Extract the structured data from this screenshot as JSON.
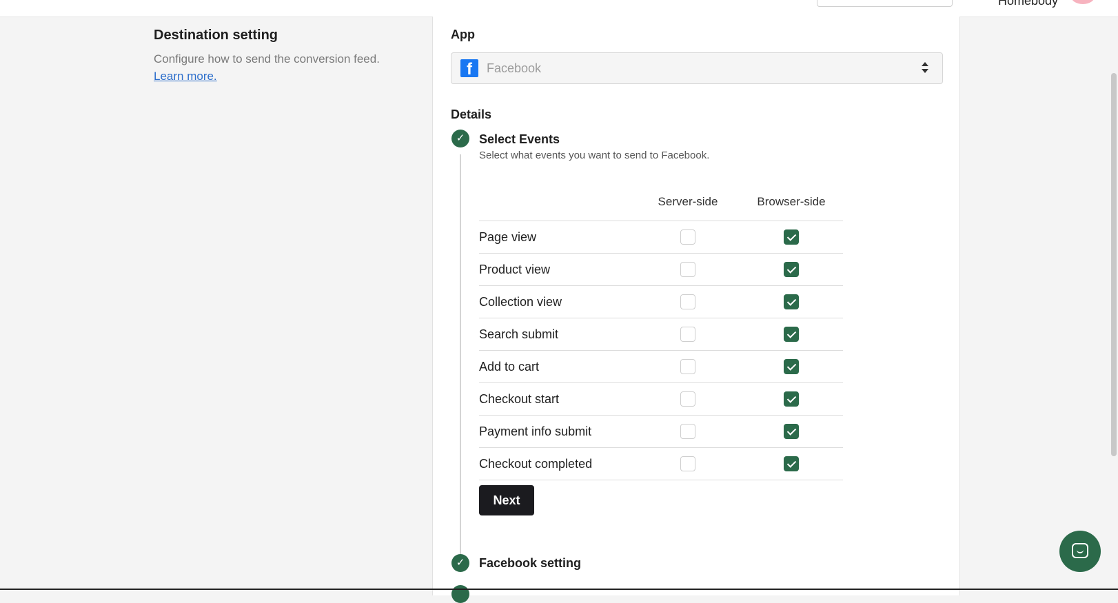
{
  "header": {
    "store_name": "Homebody"
  },
  "section": {
    "title": "Destination setting",
    "description": "Configure how to send the conversion feed.",
    "learn_more": "Learn more."
  },
  "app": {
    "label": "App",
    "selected": "Facebook",
    "icon": "facebook-icon"
  },
  "details": {
    "label": "Details",
    "steps": [
      {
        "title": "Select Events",
        "description": "Select what events you want to send to Facebook.",
        "status": "complete"
      },
      {
        "title": "Facebook setting",
        "status": "complete"
      }
    ]
  },
  "events_table": {
    "columns": [
      "Server-side",
      "Browser-side"
    ],
    "rows": [
      {
        "label": "Page view",
        "server": false,
        "browser": true
      },
      {
        "label": "Product view",
        "server": false,
        "browser": true
      },
      {
        "label": "Collection view",
        "server": false,
        "browser": true
      },
      {
        "label": "Search submit",
        "server": false,
        "browser": true
      },
      {
        "label": "Add to cart",
        "server": false,
        "browser": true
      },
      {
        "label": "Checkout start",
        "server": false,
        "browser": true
      },
      {
        "label": "Payment info submit",
        "server": false,
        "browser": true
      },
      {
        "label": "Checkout completed",
        "server": false,
        "browser": true
      }
    ]
  },
  "actions": {
    "next_label": "Next"
  },
  "colors": {
    "accent_green": "#2b6a4a",
    "facebook_blue": "#1877f2",
    "button_dark": "#1b1b1f"
  }
}
